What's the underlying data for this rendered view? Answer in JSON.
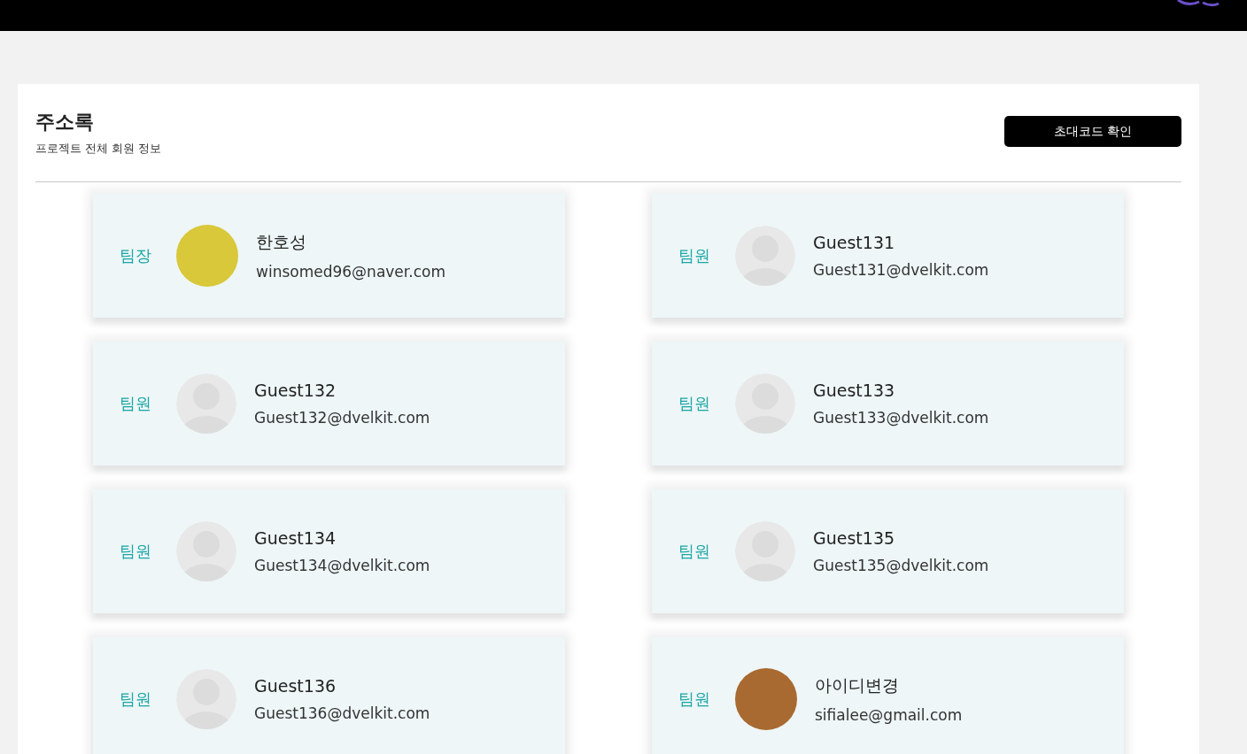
{
  "page": {
    "title": "주소록",
    "subtitle": "프로젝트 전체 회원 정보",
    "invite_button": "초대코드 확인"
  },
  "members": [
    {
      "role": "팀장",
      "name": "한호성",
      "email": "winsomed96@naver.com",
      "kind": "photo",
      "color": "#d8c83a"
    },
    {
      "role": "팀원",
      "name": "Guest131",
      "email": "Guest131@dvelkit.com",
      "kind": "default"
    },
    {
      "role": "팀원",
      "name": "Guest132",
      "email": "Guest132@dvelkit.com",
      "kind": "default"
    },
    {
      "role": "팀원",
      "name": "Guest133",
      "email": "Guest133@dvelkit.com",
      "kind": "default"
    },
    {
      "role": "팀원",
      "name": "Guest134",
      "email": "Guest134@dvelkit.com",
      "kind": "default"
    },
    {
      "role": "팀원",
      "name": "Guest135",
      "email": "Guest135@dvelkit.com",
      "kind": "default"
    },
    {
      "role": "팀원",
      "name": "Guest136",
      "email": "Guest136@dvelkit.com",
      "kind": "default"
    },
    {
      "role": "팀원",
      "name": "아이디변경",
      "email": "sifialee@gmail.com",
      "kind": "photo",
      "color": "#a86a30"
    }
  ]
}
